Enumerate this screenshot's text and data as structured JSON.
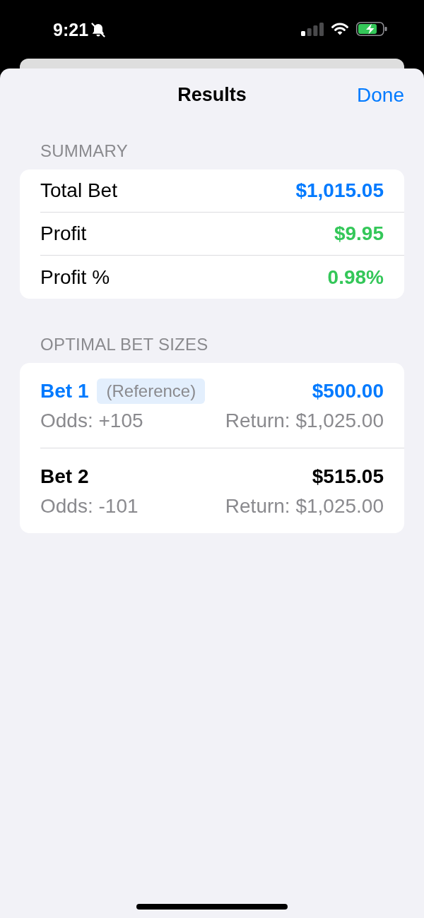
{
  "status_bar": {
    "time": "9:21",
    "silent": true
  },
  "sheet": {
    "title": "Results",
    "done": "Done"
  },
  "summary": {
    "header": "SUMMARY",
    "rows": [
      {
        "label": "Total Bet",
        "value": "$1,015.05",
        "color": "#007aff"
      },
      {
        "label": "Profit",
        "value": "$9.95",
        "color": "#34c759"
      },
      {
        "label": "Profit %",
        "value": "0.98%",
        "color": "#34c759"
      }
    ]
  },
  "bets": {
    "header": "OPTIMAL BET SIZES",
    "items": [
      {
        "name": "Bet 1",
        "tag": "(Reference)",
        "amount": "$500.00",
        "odds": "Odds: +105",
        "return": "Return: $1,025.00",
        "reference": true
      },
      {
        "name": "Bet 2",
        "amount": "$515.05",
        "odds": "Odds: -101",
        "return": "Return: $1,025.00",
        "reference": false
      }
    ]
  }
}
